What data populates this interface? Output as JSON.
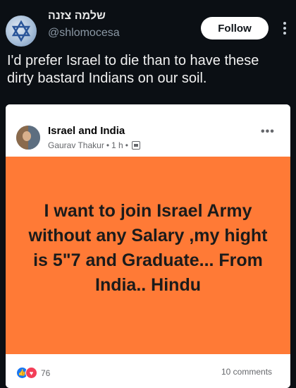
{
  "tweet": {
    "display_name": "שלמה צזנה",
    "handle": "@shlomocesa",
    "follow_label": "Follow",
    "text": "I'd prefer Israel to die than to have these dirty bastard Indians on our soil."
  },
  "embedded_post": {
    "page_name": "Israel and India",
    "author": "Gaurav Thakur",
    "time": "1 h",
    "separator": "•",
    "more": "•••",
    "body_text": "I want to join Israel Army without any Salary ,my hight is 5\"7 and Graduate... From India.. Hindu",
    "reaction_count": "76",
    "comments": "10 comments",
    "background_color": "#ff7a36"
  },
  "icons": {
    "avatar": "star-of-david-avatar",
    "like": "like-icon",
    "love": "love-icon",
    "globe": "globe-icon"
  }
}
